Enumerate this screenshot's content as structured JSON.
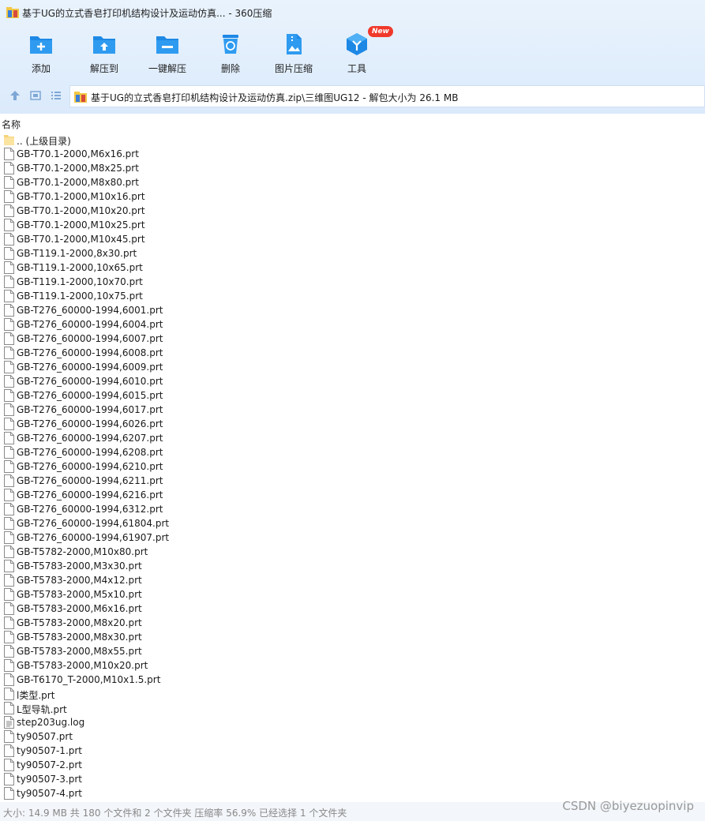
{
  "window": {
    "title": "基于UG的立式香皂打印机结构设计及运动仿真... - 360压缩"
  },
  "toolbar": {
    "items": [
      {
        "label": "添加",
        "icon": "add-folder-icon"
      },
      {
        "label": "解压到",
        "icon": "extract-to-icon"
      },
      {
        "label": "一键解压",
        "icon": "one-click-extract-icon"
      },
      {
        "label": "删除",
        "icon": "trash-icon"
      },
      {
        "label": "图片压缩",
        "icon": "image-compress-icon"
      },
      {
        "label": "工具",
        "icon": "tools-cube-icon",
        "badge": "New"
      }
    ]
  },
  "navbar": {
    "path": "基于UG的立式香皂打印机结构设计及运动仿真.zip\\三维图UG12 - 解包大小为 26.1 MB"
  },
  "list": {
    "column_name": "名称",
    "items": [
      {
        "name": ".. (上级目录)",
        "type": "folder"
      },
      {
        "name": "GB-T70.1-2000,M6x16.prt",
        "type": "file"
      },
      {
        "name": "GB-T70.1-2000,M8x25.prt",
        "type": "file"
      },
      {
        "name": "GB-T70.1-2000,M8x80.prt",
        "type": "file"
      },
      {
        "name": "GB-T70.1-2000,M10x16.prt",
        "type": "file"
      },
      {
        "name": "GB-T70.1-2000,M10x20.prt",
        "type": "file"
      },
      {
        "name": "GB-T70.1-2000,M10x25.prt",
        "type": "file"
      },
      {
        "name": "GB-T70.1-2000,M10x45.prt",
        "type": "file"
      },
      {
        "name": "GB-T119.1-2000,8x30.prt",
        "type": "file"
      },
      {
        "name": "GB-T119.1-2000,10x65.prt",
        "type": "file"
      },
      {
        "name": "GB-T119.1-2000,10x70.prt",
        "type": "file"
      },
      {
        "name": "GB-T119.1-2000,10x75.prt",
        "type": "file"
      },
      {
        "name": "GB-T276_60000-1994,6001.prt",
        "type": "file"
      },
      {
        "name": "GB-T276_60000-1994,6004.prt",
        "type": "file"
      },
      {
        "name": "GB-T276_60000-1994,6007.prt",
        "type": "file"
      },
      {
        "name": "GB-T276_60000-1994,6008.prt",
        "type": "file"
      },
      {
        "name": "GB-T276_60000-1994,6009.prt",
        "type": "file"
      },
      {
        "name": "GB-T276_60000-1994,6010.prt",
        "type": "file"
      },
      {
        "name": "GB-T276_60000-1994,6015.prt",
        "type": "file"
      },
      {
        "name": "GB-T276_60000-1994,6017.prt",
        "type": "file"
      },
      {
        "name": "GB-T276_60000-1994,6026.prt",
        "type": "file"
      },
      {
        "name": "GB-T276_60000-1994,6207.prt",
        "type": "file"
      },
      {
        "name": "GB-T276_60000-1994,6208.prt",
        "type": "file"
      },
      {
        "name": "GB-T276_60000-1994,6210.prt",
        "type": "file"
      },
      {
        "name": "GB-T276_60000-1994,6211.prt",
        "type": "file"
      },
      {
        "name": "GB-T276_60000-1994,6216.prt",
        "type": "file"
      },
      {
        "name": "GB-T276_60000-1994,6312.prt",
        "type": "file"
      },
      {
        "name": "GB-T276_60000-1994,61804.prt",
        "type": "file"
      },
      {
        "name": "GB-T276_60000-1994,61907.prt",
        "type": "file"
      },
      {
        "name": "GB-T5782-2000,M10x80.prt",
        "type": "file"
      },
      {
        "name": "GB-T5783-2000,M3x30.prt",
        "type": "file"
      },
      {
        "name": "GB-T5783-2000,M4x12.prt",
        "type": "file"
      },
      {
        "name": "GB-T5783-2000,M5x10.prt",
        "type": "file"
      },
      {
        "name": "GB-T5783-2000,M6x16.prt",
        "type": "file"
      },
      {
        "name": "GB-T5783-2000,M8x20.prt",
        "type": "file"
      },
      {
        "name": "GB-T5783-2000,M8x30.prt",
        "type": "file"
      },
      {
        "name": "GB-T5783-2000,M8x55.prt",
        "type": "file"
      },
      {
        "name": "GB-T5783-2000,M10x20.prt",
        "type": "file"
      },
      {
        "name": "GB-T6170_T-2000,M10x1.5.prt",
        "type": "file"
      },
      {
        "name": "l类型.prt",
        "type": "file"
      },
      {
        "name": "L型导轨.prt",
        "type": "file"
      },
      {
        "name": "step203ug.log",
        "type": "log"
      },
      {
        "name": "ty90507.prt",
        "type": "file"
      },
      {
        "name": "ty90507-1.prt",
        "type": "file"
      },
      {
        "name": "ty90507-2.prt",
        "type": "file"
      },
      {
        "name": "ty90507-3.prt",
        "type": "file"
      },
      {
        "name": "ty90507-4.prt",
        "type": "file"
      }
    ]
  },
  "status": {
    "text": "大小: 14.9 MB 共 180 个文件和 2 个文件夹 压缩率 56.9% 已经选择 1 个文件夹"
  },
  "watermark": "CSDN @biyezuopinvip",
  "colors": {
    "accent": "#1e88e5",
    "toolbar_bg": "#e3effc",
    "badge": "#f0392b"
  }
}
